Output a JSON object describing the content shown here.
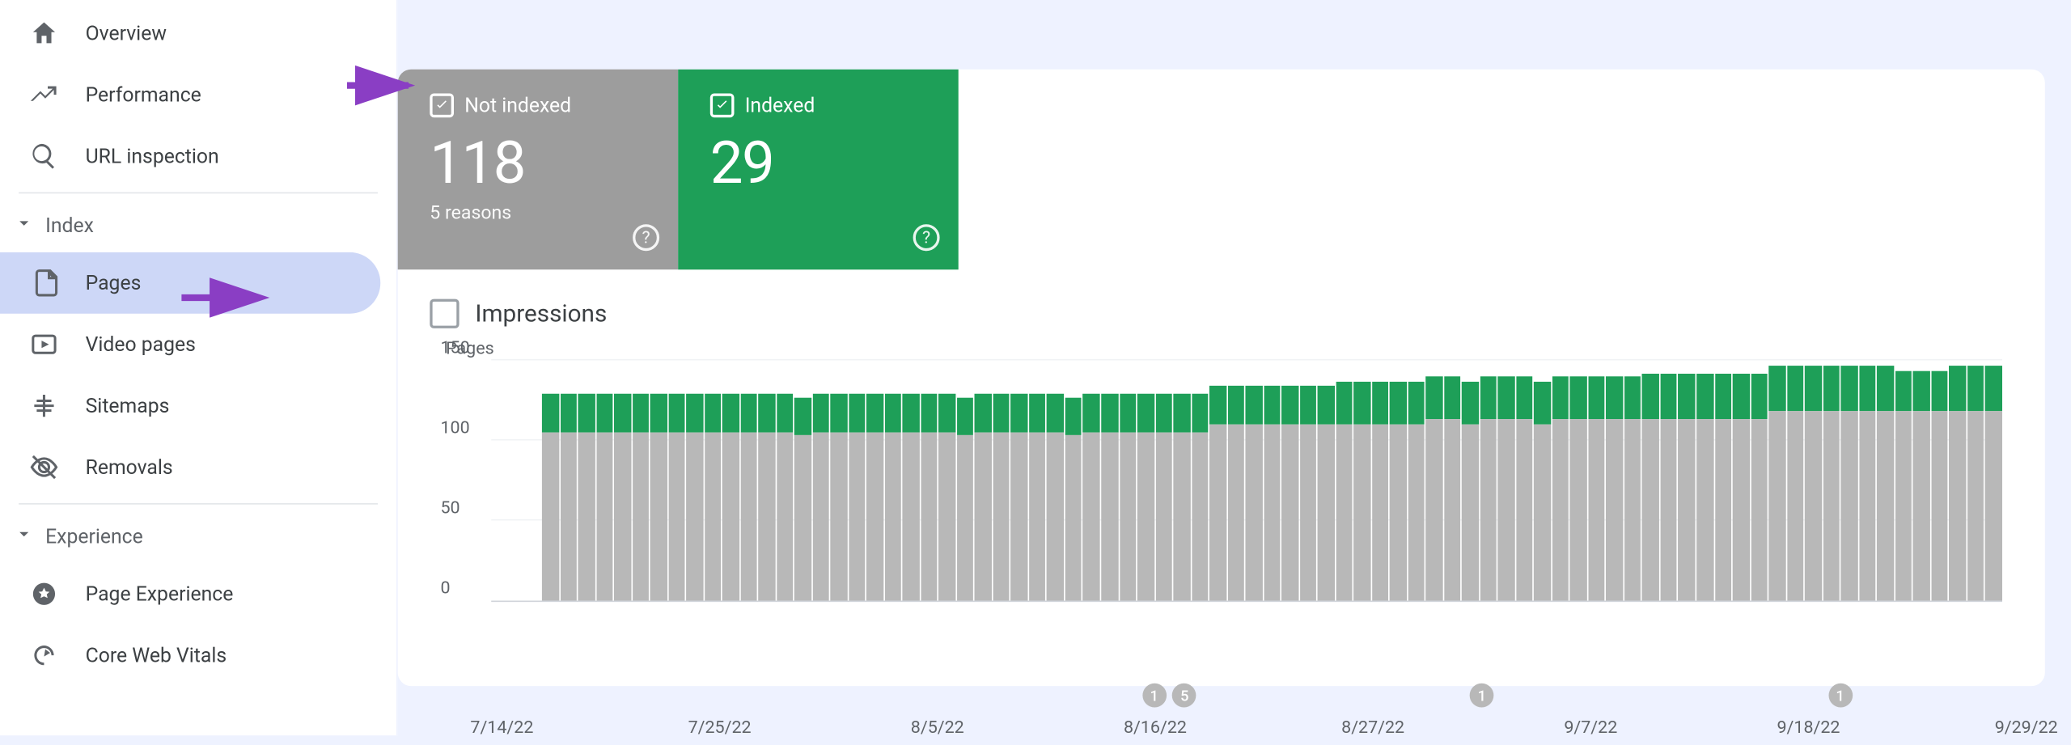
{
  "sidebar": {
    "top_items": [
      {
        "label": "Overview",
        "icon": "home"
      },
      {
        "label": "Performance",
        "icon": "trend"
      },
      {
        "label": "URL inspection",
        "icon": "search"
      }
    ],
    "sections": [
      {
        "title": "Index",
        "items": [
          {
            "label": "Pages",
            "icon": "pages",
            "active": true
          },
          {
            "label": "Video pages",
            "icon": "video"
          },
          {
            "label": "Sitemaps",
            "icon": "sitemap"
          },
          {
            "label": "Removals",
            "icon": "eyeoff"
          }
        ]
      },
      {
        "title": "Experience",
        "items": [
          {
            "label": "Page Experience",
            "icon": "star"
          },
          {
            "label": "Core Web Vitals",
            "icon": "speed"
          }
        ]
      }
    ]
  },
  "tiles": {
    "not_indexed": {
      "label": "Not indexed",
      "value": "118",
      "sub": "5 reasons"
    },
    "indexed": {
      "label": "Indexed",
      "value": "29"
    }
  },
  "impressions_label": "Impressions",
  "chart_data": {
    "type": "bar",
    "title": "Pages",
    "ylabel": "Pages",
    "ylim": [
      0,
      150
    ],
    "yticks": [
      0,
      50,
      100,
      150
    ],
    "xticks": [
      "7/14/22",
      "7/25/22",
      "8/5/22",
      "8/16/22",
      "8/27/22",
      "9/7/22",
      "9/18/22",
      "9/29/22"
    ],
    "series_names": [
      "Not indexed",
      "Indexed"
    ],
    "events": [
      {
        "x": "8/16/22",
        "count": 1
      },
      {
        "x": "8/17/22",
        "count": 5
      },
      {
        "x": "9/2/22",
        "count": 1
      },
      {
        "x": "9/20/22",
        "count": 1
      }
    ],
    "data": [
      {
        "ni": 105,
        "ix": 24
      },
      {
        "ni": 105,
        "ix": 24
      },
      {
        "ni": 105,
        "ix": 24
      },
      {
        "ni": 105,
        "ix": 24
      },
      {
        "ni": 105,
        "ix": 24
      },
      {
        "ni": 105,
        "ix": 24
      },
      {
        "ni": 105,
        "ix": 24
      },
      {
        "ni": 105,
        "ix": 24
      },
      {
        "ni": 105,
        "ix": 24
      },
      {
        "ni": 105,
        "ix": 24
      },
      {
        "ni": 105,
        "ix": 24
      },
      {
        "ni": 105,
        "ix": 24
      },
      {
        "ni": 105,
        "ix": 24
      },
      {
        "ni": 105,
        "ix": 24
      },
      {
        "ni": 103,
        "ix": 24
      },
      {
        "ni": 105,
        "ix": 24
      },
      {
        "ni": 105,
        "ix": 24
      },
      {
        "ni": 105,
        "ix": 24
      },
      {
        "ni": 105,
        "ix": 24
      },
      {
        "ni": 105,
        "ix": 24
      },
      {
        "ni": 105,
        "ix": 24
      },
      {
        "ni": 105,
        "ix": 24
      },
      {
        "ni": 105,
        "ix": 24
      },
      {
        "ni": 103,
        "ix": 24
      },
      {
        "ni": 105,
        "ix": 24
      },
      {
        "ni": 105,
        "ix": 24
      },
      {
        "ni": 105,
        "ix": 24
      },
      {
        "ni": 105,
        "ix": 24
      },
      {
        "ni": 105,
        "ix": 24
      },
      {
        "ni": 103,
        "ix": 24
      },
      {
        "ni": 105,
        "ix": 24
      },
      {
        "ni": 105,
        "ix": 24
      },
      {
        "ni": 105,
        "ix": 24
      },
      {
        "ni": 105,
        "ix": 24
      },
      {
        "ni": 105,
        "ix": 24
      },
      {
        "ni": 105,
        "ix": 24
      },
      {
        "ni": 105,
        "ix": 24
      },
      {
        "ni": 110,
        "ix": 24
      },
      {
        "ni": 110,
        "ix": 24
      },
      {
        "ni": 110,
        "ix": 24
      },
      {
        "ni": 110,
        "ix": 24
      },
      {
        "ni": 110,
        "ix": 24
      },
      {
        "ni": 110,
        "ix": 24
      },
      {
        "ni": 110,
        "ix": 24
      },
      {
        "ni": 110,
        "ix": 27
      },
      {
        "ni": 110,
        "ix": 27
      },
      {
        "ni": 110,
        "ix": 27
      },
      {
        "ni": 110,
        "ix": 27
      },
      {
        "ni": 110,
        "ix": 27
      },
      {
        "ni": 113,
        "ix": 27
      },
      {
        "ni": 113,
        "ix": 27
      },
      {
        "ni": 110,
        "ix": 27
      },
      {
        "ni": 113,
        "ix": 27
      },
      {
        "ni": 113,
        "ix": 27
      },
      {
        "ni": 113,
        "ix": 27
      },
      {
        "ni": 110,
        "ix": 27
      },
      {
        "ni": 113,
        "ix": 27
      },
      {
        "ni": 113,
        "ix": 27
      },
      {
        "ni": 113,
        "ix": 27
      },
      {
        "ni": 113,
        "ix": 27
      },
      {
        "ni": 113,
        "ix": 27
      },
      {
        "ni": 113,
        "ix": 29
      },
      {
        "ni": 113,
        "ix": 29
      },
      {
        "ni": 113,
        "ix": 29
      },
      {
        "ni": 113,
        "ix": 29
      },
      {
        "ni": 113,
        "ix": 29
      },
      {
        "ni": 113,
        "ix": 29
      },
      {
        "ni": 113,
        "ix": 29
      },
      {
        "ni": 118,
        "ix": 29
      },
      {
        "ni": 118,
        "ix": 29
      },
      {
        "ni": 118,
        "ix": 29
      },
      {
        "ni": 118,
        "ix": 29
      },
      {
        "ni": 118,
        "ix": 29
      },
      {
        "ni": 118,
        "ix": 29
      },
      {
        "ni": 118,
        "ix": 29
      },
      {
        "ni": 118,
        "ix": 25
      },
      {
        "ni": 118,
        "ix": 25
      },
      {
        "ni": 118,
        "ix": 25
      },
      {
        "ni": 118,
        "ix": 29
      },
      {
        "ni": 118,
        "ix": 29
      },
      {
        "ni": 118,
        "ix": 29
      }
    ]
  }
}
